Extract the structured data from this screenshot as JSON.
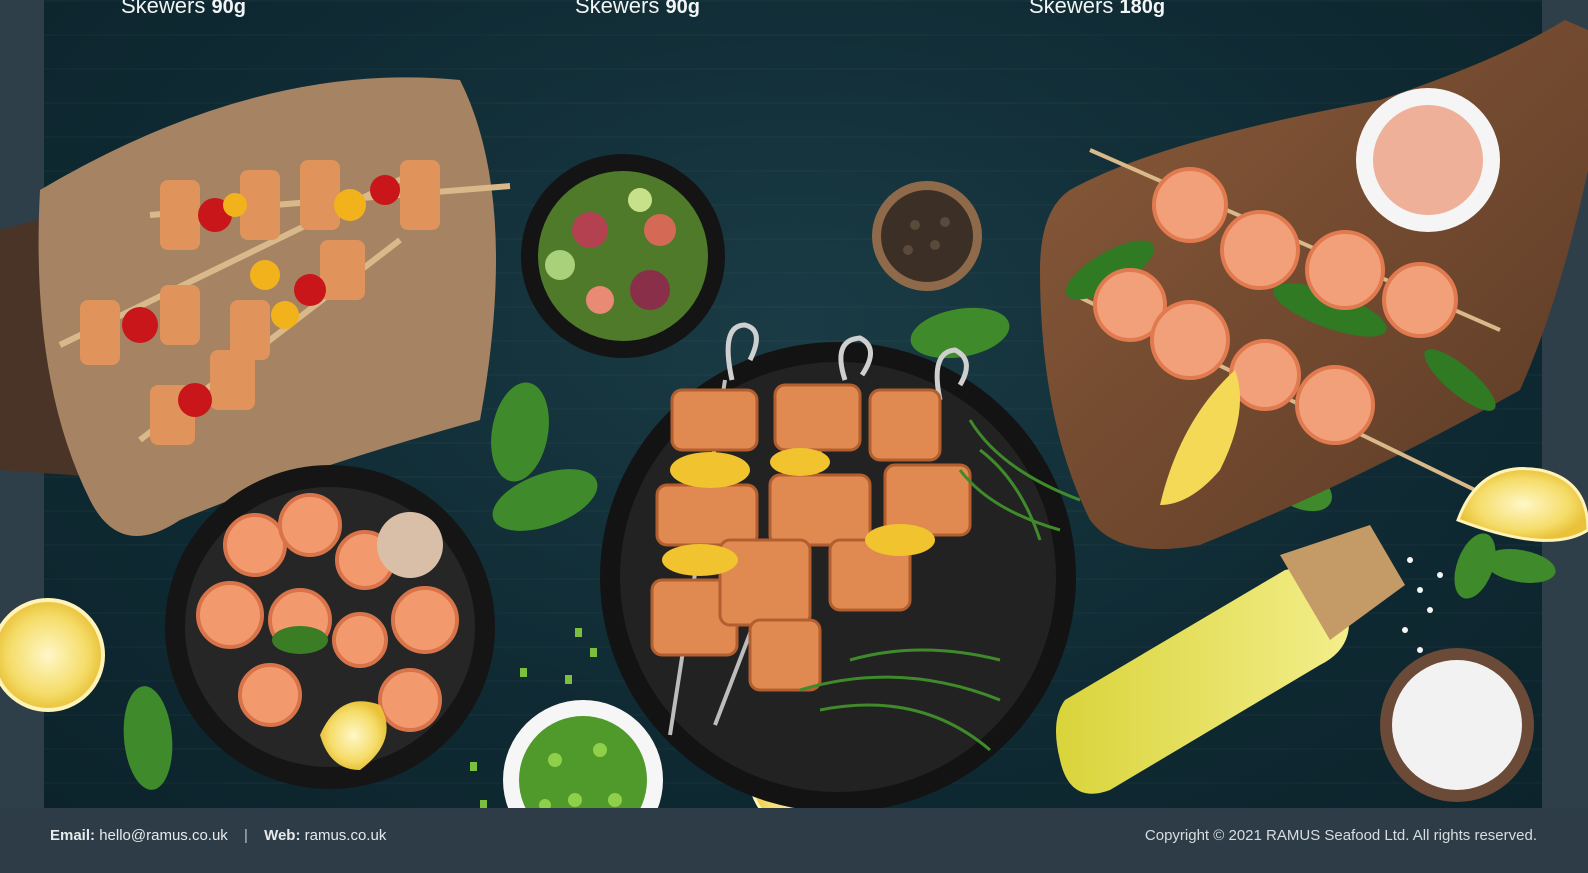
{
  "products": [
    {
      "name": "Skewers",
      "weight": "90g"
    },
    {
      "name": "Skewers",
      "weight": "90g"
    },
    {
      "name": "Skewers",
      "weight": "180g"
    }
  ],
  "footer": {
    "email_label": "Email:",
    "email_value": "hello@ramus.co.uk",
    "separator": "|",
    "web_label": "Web:",
    "web_value": "ramus.co.uk",
    "copyright": "Copyright © 2021 RAMUS Seafood Ltd. All rights reserved."
  },
  "colors": {
    "background": "#0f2a33",
    "footer": "#2d3c46",
    "text": "#f2f4f5"
  }
}
